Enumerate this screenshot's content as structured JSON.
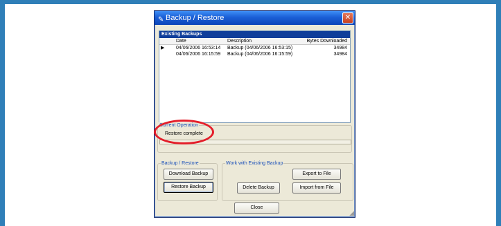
{
  "window": {
    "title": "Backup / Restore",
    "close_glyph": "✕",
    "app_icon": "✎",
    "app_icon_name": "pencil-icon"
  },
  "existing_backups": {
    "caption": "Existing Backups",
    "columns": [
      "Date",
      "Description",
      "Bytes Downloaded"
    ],
    "rows": [
      {
        "date": "04/06/2006 16:53:14",
        "description": "Backup (04/06/2006 16:53:15)",
        "bytes": "34984",
        "current": true
      },
      {
        "date": "04/06/2006 16:15:59",
        "description": "Backup (04/06/2006 16:15:59)",
        "bytes": "34984",
        "current": false
      }
    ],
    "current_row_marker": "▶"
  },
  "current_operation": {
    "label": "Current Operation",
    "status": "Restore complete"
  },
  "backup_restore_group": {
    "label": "Backup / Restore",
    "download_label": "Download Backup",
    "restore_label": "Restore Backup"
  },
  "work_group": {
    "label": "Work with Existing Backup",
    "delete_label": "Delete Backup",
    "export_label": "Export to File",
    "import_label": "Import from File"
  },
  "footer": {
    "close_label": "Close"
  },
  "colors": {
    "page_border": "#2f7fb8",
    "titlebar": "#1b5fd6",
    "highlight_ring": "#e41e2a",
    "group_title": "#1a4fb8"
  }
}
